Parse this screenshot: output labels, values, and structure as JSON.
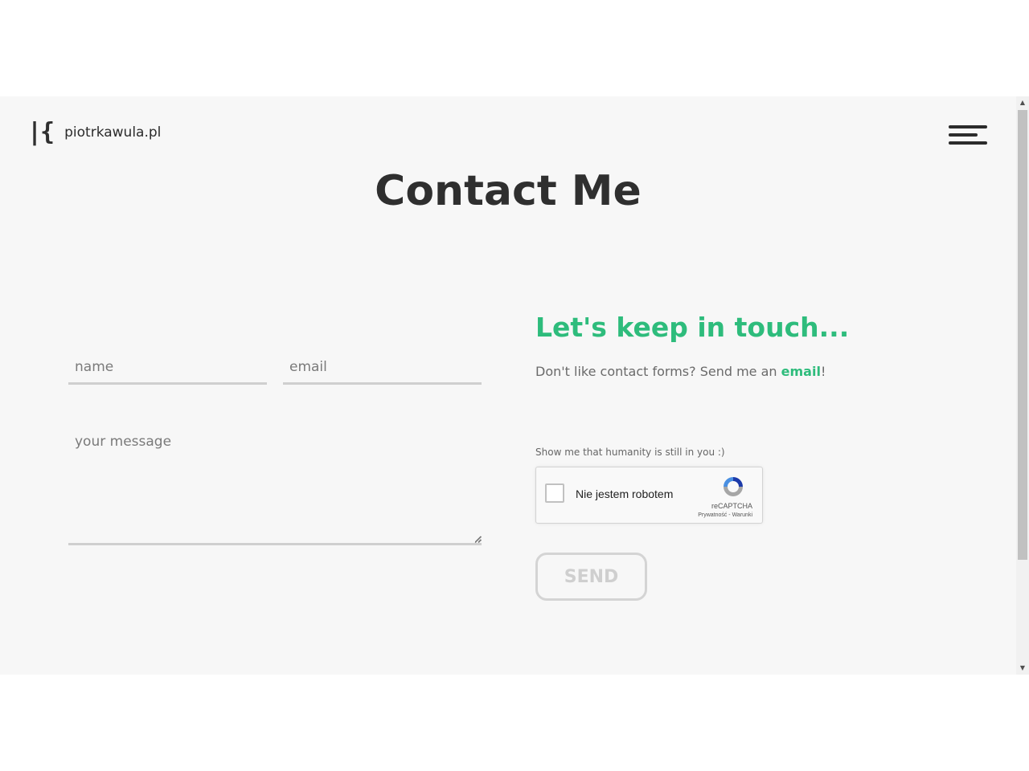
{
  "header": {
    "logo_mark": "|{",
    "site_name": "piotrkawula.pl"
  },
  "page": {
    "title": "Contact Me"
  },
  "form": {
    "name_placeholder": "name",
    "email_placeholder": "email",
    "message_placeholder": "your message",
    "send_label": "SEND"
  },
  "aside": {
    "heading": "Let's keep in touch...",
    "text_before": "Don't like contact forms? Send me an ",
    "email_link": "email",
    "text_after": "!",
    "humanity_label": "Show me that humanity is still in you :)"
  },
  "recaptcha": {
    "label": "Nie jestem robotem",
    "brand": "reCAPTCHA",
    "links": "Prywatność - Warunki"
  },
  "colors": {
    "accent": "#2ebc7c",
    "text_dark": "#2f2f2f",
    "background": "#f7f7f7"
  },
  "icons": {
    "menu": "hamburger-menu-icon",
    "recaptcha": "recaptcha-logo-icon",
    "scroll_up": "scroll-up-arrow-icon",
    "scroll_down": "scroll-down-arrow-icon"
  }
}
